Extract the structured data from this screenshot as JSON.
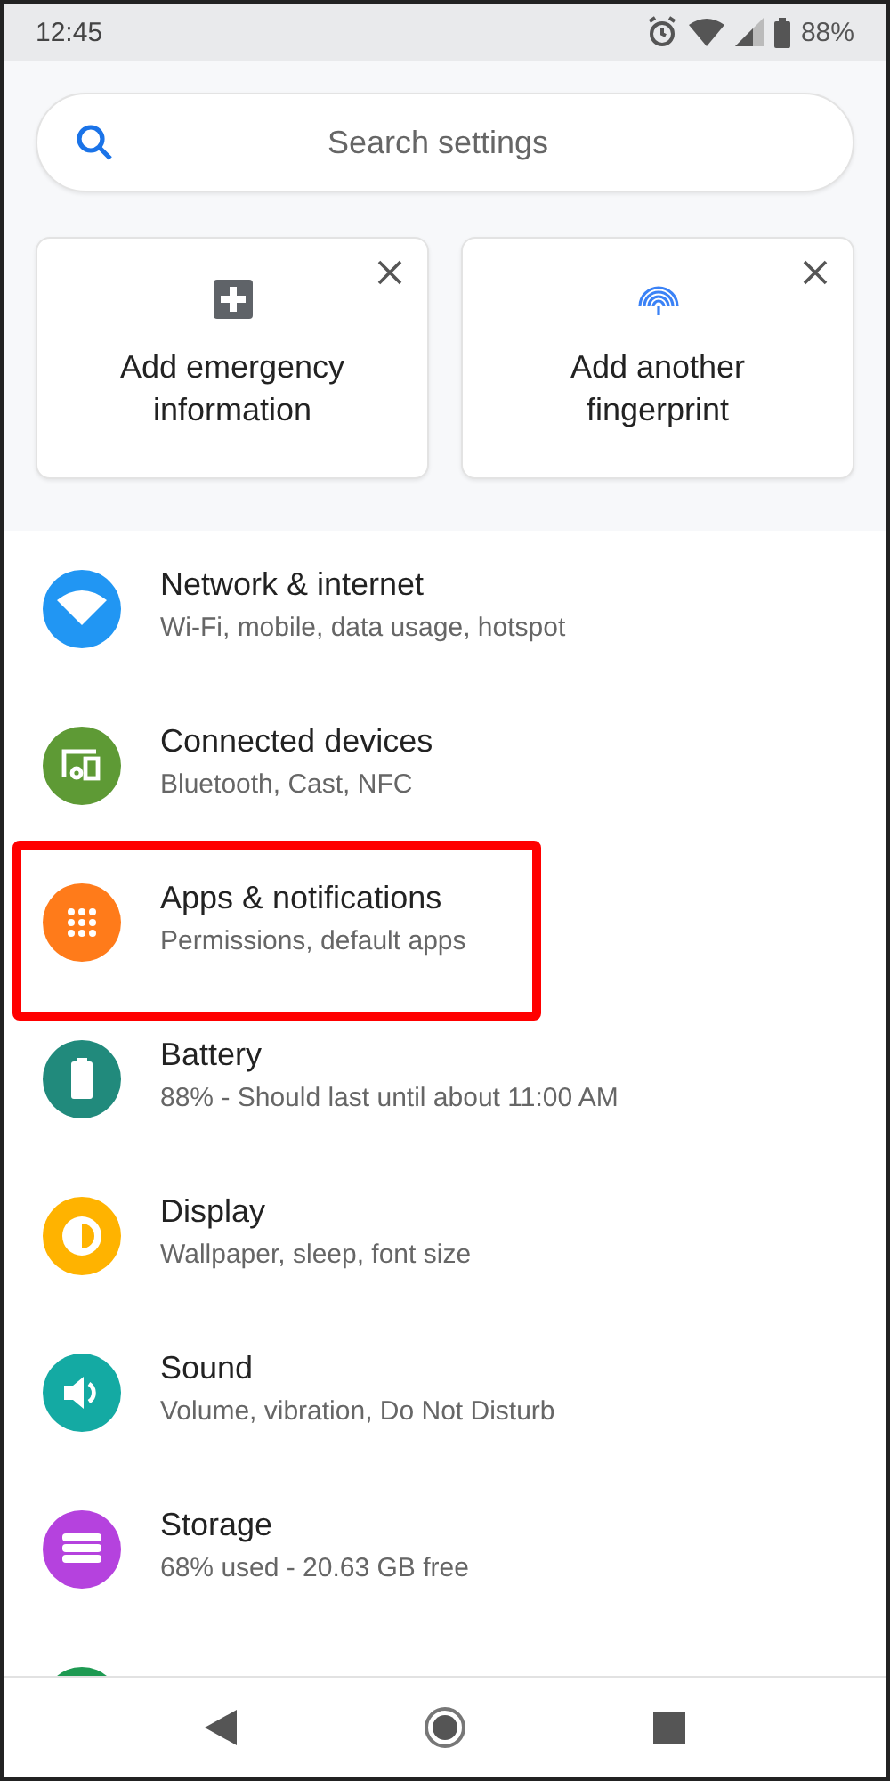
{
  "status_bar": {
    "time": "12:45",
    "battery": "88%"
  },
  "search": {
    "placeholder": "Search settings"
  },
  "suggestions": [
    {
      "kind": "emergency",
      "label": "Add emergency information"
    },
    {
      "kind": "fingerprint",
      "label": "Add another fingerprint"
    }
  ],
  "settings": [
    {
      "kind": "network",
      "color": "#2196f3",
      "title": "Network & internet",
      "subtitle": "Wi-Fi, mobile, data usage, hotspot",
      "highlighted": false
    },
    {
      "kind": "devices",
      "color": "#5e9a35",
      "title": "Connected devices",
      "subtitle": "Bluetooth, Cast, NFC",
      "highlighted": false
    },
    {
      "kind": "apps",
      "color": "#ff7b1a",
      "title": "Apps & notifications",
      "subtitle": "Permissions, default apps",
      "highlighted": true
    },
    {
      "kind": "battery",
      "color": "#218a7c",
      "title": "Battery",
      "subtitle": "88% - Should last until about 11:00 AM",
      "highlighted": false
    },
    {
      "kind": "display",
      "color": "#ffb300",
      "title": "Display",
      "subtitle": "Wallpaper, sleep, font size",
      "highlighted": false
    },
    {
      "kind": "sound",
      "color": "#14aaa3",
      "title": "Sound",
      "subtitle": "Volume, vibration, Do Not Disturb",
      "highlighted": false
    },
    {
      "kind": "storage",
      "color": "#b542de",
      "title": "Storage",
      "subtitle": "68% used - 20.63 GB free",
      "highlighted": false
    },
    {
      "kind": "security",
      "color": "#1e9a52",
      "highlighted": false
    }
  ]
}
